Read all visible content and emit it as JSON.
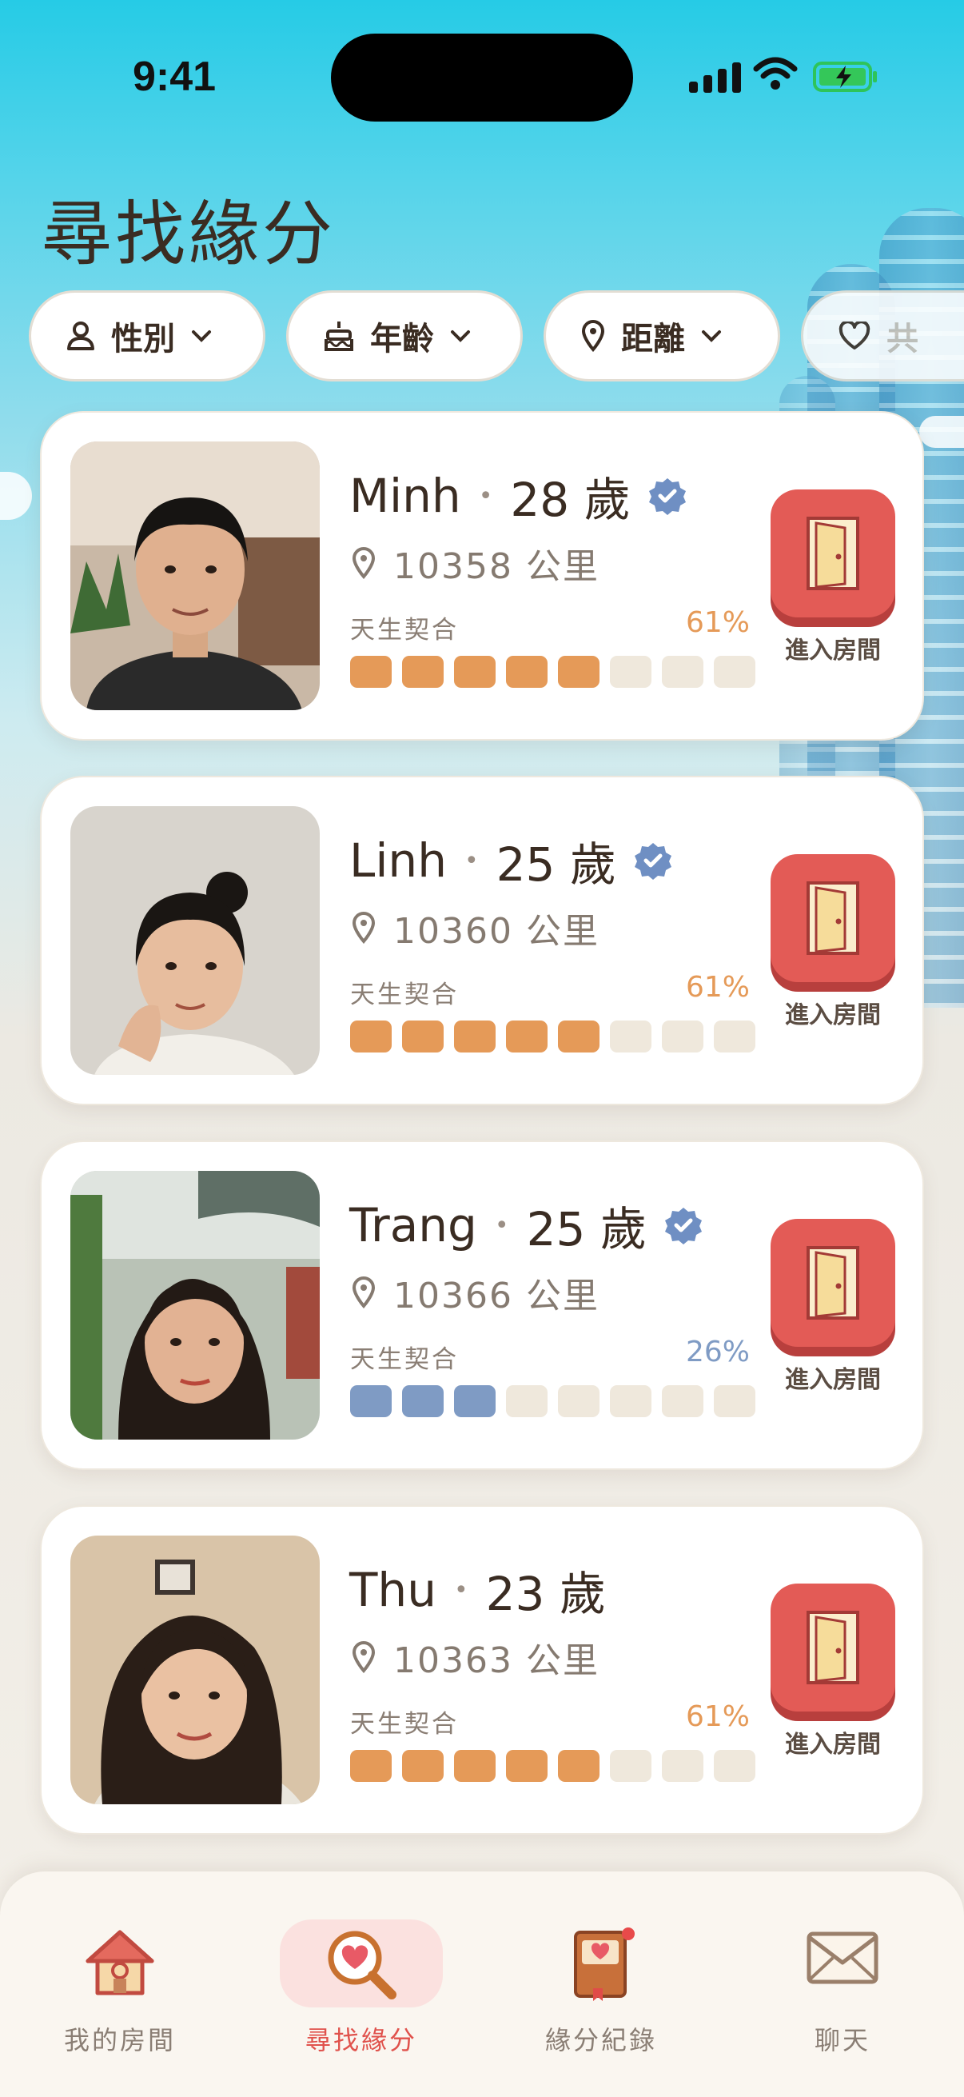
{
  "status_bar": {
    "time": "9:41"
  },
  "page_title": "尋找緣分",
  "filters": [
    {
      "label": "性別",
      "icon": "person-icon"
    },
    {
      "label": "年齡",
      "icon": "cake-icon"
    },
    {
      "label": "距離",
      "icon": "location-pin-icon"
    },
    {
      "label": "共",
      "icon": "heart-icon"
    }
  ],
  "colors": {
    "accent_red": "#e35b56",
    "match_orange": "#e59a58",
    "match_blue": "#7f9bc4",
    "seg_empty": "#efe8dc"
  },
  "profiles": [
    {
      "name": "Minh",
      "age": "28 歲",
      "verified": true,
      "distance": "10358 公里",
      "compat_label": "天生契合",
      "compat_pct": "61%",
      "filled_segments": 5,
      "total_segments": 8,
      "color": "#e59a58",
      "enter_label": "進入房間"
    },
    {
      "name": "Linh",
      "age": "25 歲",
      "verified": true,
      "distance": "10360 公里",
      "compat_label": "天生契合",
      "compat_pct": "61%",
      "filled_segments": 5,
      "total_segments": 8,
      "color": "#e59a58",
      "enter_label": "進入房間"
    },
    {
      "name": "Trang",
      "age": "25 歲",
      "verified": true,
      "distance": "10366 公里",
      "compat_label": "天生契合",
      "compat_pct": "26%",
      "filled_segments": 3,
      "total_segments": 8,
      "color": "#7f9bc4",
      "enter_label": "進入房間"
    },
    {
      "name": "Thu",
      "age": "23 歲",
      "verified": false,
      "distance": "10363 公里",
      "compat_label": "天生契合",
      "compat_pct": "61%",
      "filled_segments": 5,
      "total_segments": 8,
      "color": "#e59a58",
      "enter_label": "進入房間"
    }
  ],
  "nav": [
    {
      "label": "我的房間",
      "icon": "house-icon",
      "active": false
    },
    {
      "label": "尋找緣分",
      "icon": "magnifier-heart-icon",
      "active": true
    },
    {
      "label": "緣分紀錄",
      "icon": "book-icon",
      "active": false,
      "badge": true
    },
    {
      "label": "聊天",
      "icon": "envelope-icon",
      "active": false
    }
  ]
}
